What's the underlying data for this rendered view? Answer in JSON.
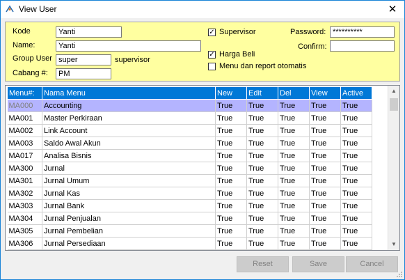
{
  "window": {
    "title": "View User",
    "close_glyph": "✕"
  },
  "form": {
    "kode_label": "Kode",
    "kode_value": "Yanti",
    "name_label": "Name:",
    "name_value": "Yanti",
    "group_label": "Group User",
    "group_value": "super",
    "group_desc": "supervisor",
    "cabang_label": "Cabang #:",
    "cabang_value": "PM",
    "supervisor_label": "Supervisor",
    "supervisor_checked": true,
    "harga_label": "Harga Beli",
    "harga_checked": true,
    "menu_report_label": "Menu dan report otomatis",
    "menu_report_checked": false,
    "password_label": "Password:",
    "password_value": "**********",
    "confirm_label": "Confirm:",
    "confirm_value": ""
  },
  "grid": {
    "columns": [
      "Menu#:",
      "Nama Menu",
      "New",
      "Edit",
      "Del",
      "View",
      "Active"
    ],
    "rows": [
      [
        "MA000",
        "Accounting",
        "True",
        "True",
        "True",
        "True",
        "True"
      ],
      [
        "MA001",
        "Master Perkiraan",
        "True",
        "True",
        "True",
        "True",
        "True"
      ],
      [
        "MA002",
        "Link Account",
        "True",
        "True",
        "True",
        "True",
        "True"
      ],
      [
        "MA003",
        "Saldo Awal Akun",
        "True",
        "True",
        "True",
        "True",
        "True"
      ],
      [
        "MA017",
        "Analisa Bisnis",
        "True",
        "True",
        "True",
        "True",
        "True"
      ],
      [
        "MA300",
        "Jurnal",
        "True",
        "True",
        "True",
        "True",
        "True"
      ],
      [
        "MA301",
        "Jurnal Umum",
        "True",
        "True",
        "True",
        "True",
        "True"
      ],
      [
        "MA302",
        "Jurnal Kas",
        "True",
        "True",
        "True",
        "True",
        "True"
      ],
      [
        "MA303",
        "Jurnal Bank",
        "True",
        "True",
        "True",
        "True",
        "True"
      ],
      [
        "MA304",
        "Jurnal Penjualan",
        "True",
        "True",
        "True",
        "True",
        "True"
      ],
      [
        "MA305",
        "Jurnal Pembelian",
        "True",
        "True",
        "True",
        "True",
        "True"
      ],
      [
        "MA306",
        "Jurnal Persediaan",
        "True",
        "True",
        "True",
        "True",
        "True"
      ]
    ],
    "selected_row": 0
  },
  "buttons": {
    "reset": "Reset",
    "save": "Save",
    "cancel": "Cancel"
  },
  "colors": {
    "panel_bg": "#ffffa0",
    "header_bg": "#0078d7",
    "selected_row": "#b4b4ff"
  }
}
